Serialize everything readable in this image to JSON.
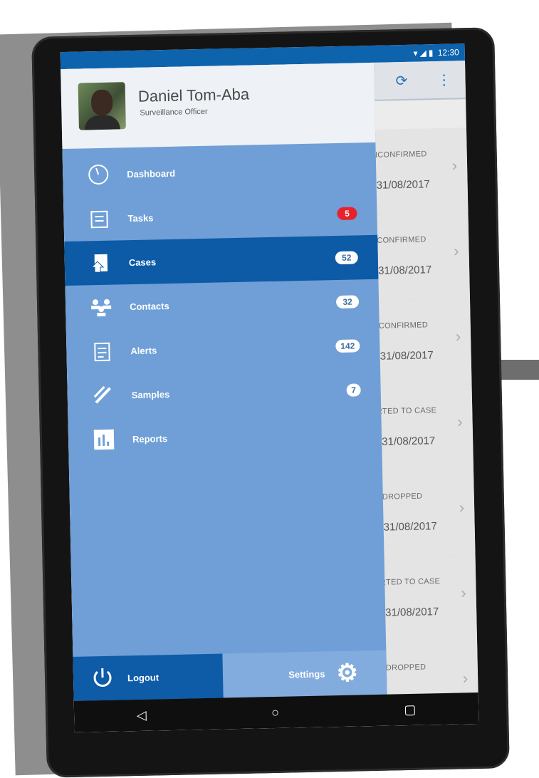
{
  "statusbar": {
    "time": "12:30"
  },
  "profile": {
    "name": "Daniel Tom-Aba",
    "role": "Surveillance Officer"
  },
  "nav": {
    "items": [
      {
        "label": "Dashboard",
        "icon": "dashboard-icon",
        "badge": ""
      },
      {
        "label": "Tasks",
        "icon": "tasks-icon",
        "badge": "5"
      },
      {
        "label": "Cases",
        "icon": "cases-icon",
        "badge": "52"
      },
      {
        "label": "Contacts",
        "icon": "contacts-icon",
        "badge": "32"
      },
      {
        "label": "Alerts",
        "icon": "alerts-icon",
        "badge": "142"
      },
      {
        "label": "Samples",
        "icon": "samples-icon",
        "badge": "7"
      },
      {
        "label": "Reports",
        "icon": "reports-icon",
        "badge": ""
      }
    ]
  },
  "footer": {
    "logout": "Logout",
    "settings": "Settings"
  },
  "list": {
    "rows": [
      {
        "status": "UNCONFIRMED",
        "date": "31/08/2017",
        "dot": ""
      },
      {
        "status": "CONFIRMED",
        "date": "31/08/2017",
        "dot": "#d23b3b"
      },
      {
        "status": "CONFIRMED",
        "date": "31/08/2017",
        "dot": "#d23b3b"
      },
      {
        "status": "ERTED TO CASE",
        "date": "31/08/2017",
        "dot": ""
      },
      {
        "status": "DROPPED",
        "date": "31/08/2017",
        "dot": "#3a6fb0"
      },
      {
        "status": "ERTED TO CASE",
        "date": "31/08/2017",
        "dot": ""
      },
      {
        "status": "DROPPED",
        "date": "",
        "dot": "#3a6fb0"
      }
    ]
  },
  "colors": {
    "primary": "#0d5aa6",
    "drawer": "#6f9fd6",
    "badge_alert": "#e8212a"
  }
}
